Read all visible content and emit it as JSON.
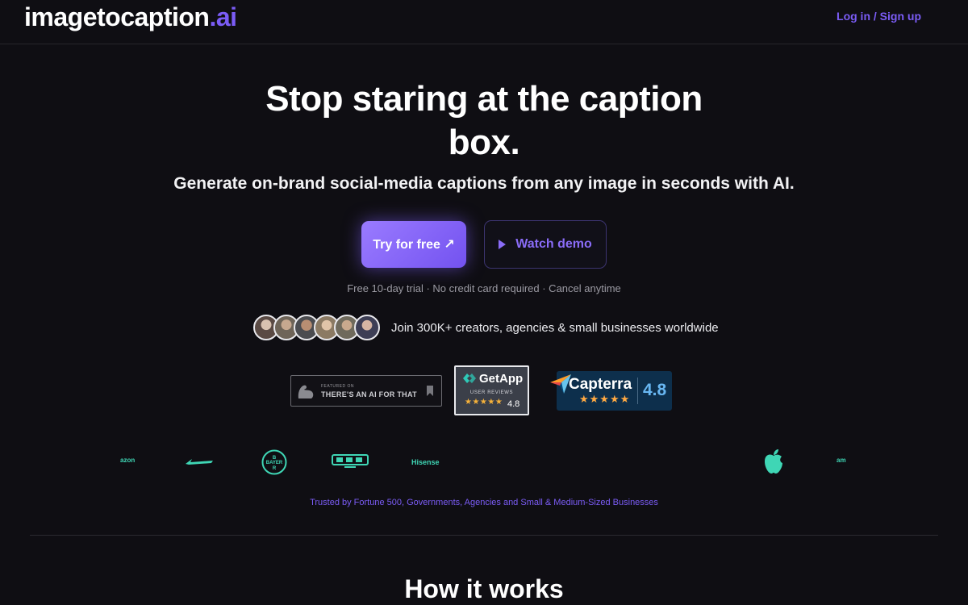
{
  "header": {
    "logo_main": "imagetocaption",
    "logo_tld": ".ai",
    "login_label": "Log in / Sign up"
  },
  "hero": {
    "title": "Stop staring at the caption box.",
    "subtitle": "Generate on-brand social-media captions from any image in seconds with AI.",
    "primary_cta": "Try for free ↗",
    "secondary_cta": "Watch demo",
    "trial_note": "Free 10-day trial · No credit card required · Cancel anytime"
  },
  "social_proof": {
    "text": "Join 300K+ creators, agencies & small businesses worldwide",
    "avatar_count": 6
  },
  "badges": {
    "aift": {
      "small": "FEATURED ON",
      "main": "THERE'S AN AI FOR THAT"
    },
    "getapp": {
      "name": "GetApp",
      "reviews": "USER REVIEWS",
      "stars": "★★★★★",
      "rating": "4.8"
    },
    "capterra": {
      "name": "Capterra",
      "stars": "★★★★★",
      "rating": "4.8"
    }
  },
  "client_logos": {
    "amazon_left": "azon",
    "hisense": "Hisense",
    "amazon_right": "am"
  },
  "trusted_text": "Trusted by Fortune 500, Governments, Agencies and Small & Medium-Sized Businesses",
  "section": {
    "how_title": "How it works"
  },
  "colors": {
    "accent": "#7b5cf6",
    "background": "#0f0e13",
    "logo_teal": "#3fd6b5"
  }
}
